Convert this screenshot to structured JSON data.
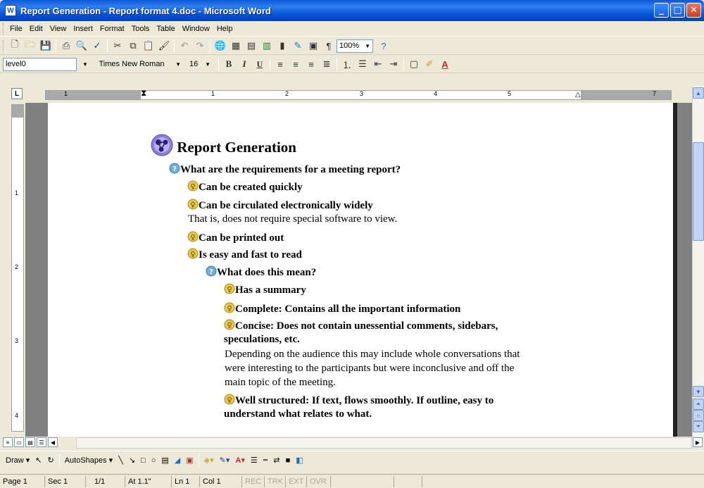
{
  "window": {
    "title": "Report Generation - Report format 4.doc - Microsoft Word",
    "icon": "W"
  },
  "menu": [
    "File",
    "Edit",
    "View",
    "Insert",
    "Format",
    "Tools",
    "Table",
    "Window",
    "Help"
  ],
  "toolbar": {
    "zoom": "100%",
    "style": "level0",
    "font": "Times New Roman",
    "size": "16",
    "bold": "B",
    "italic": "I",
    "underline": "U"
  },
  "ruler": {
    "tab_selector": "L",
    "h_numbers": [
      "1",
      "1",
      "2",
      "3",
      "4",
      "5",
      "7"
    ],
    "v_numbers": [
      "1",
      "2",
      "3",
      "4"
    ]
  },
  "document": {
    "title": "Report Generation",
    "q1": "What are the requirements for a meeting report?",
    "i1": "Can be created quickly",
    "i2": "Can be circulated electronically widely",
    "i2_note": "That is, does not require special software to view.",
    "i3": "Can be printed out",
    "i4": "Is easy and fast to read",
    "q2": "What does this mean?",
    "s1": "Has a summary",
    "s2": "Complete: Contains all the important information",
    "s3a": "Concise: Does not contain unessential comments, sidebars,",
    "s3b": "speculations, etc.",
    "s3_note1": "Depending on the audience this may include whole conversations that",
    "s3_note2": "were interesting to the participants but were inconclusive and off the",
    "s3_note3": "main topic of the meeting.",
    "s4a": "Well structured: If text, flows smoothly. If outline, easy to",
    "s4b": "understand what relates to what."
  },
  "drawbar": {
    "draw": "Draw",
    "autoshapes": "AutoShapes"
  },
  "status": {
    "page": "Page 1",
    "sec": "Sec 1",
    "pages": "1/1",
    "at": "At 1.1\"",
    "ln": "Ln 1",
    "col": "Col 1",
    "rec": "REC",
    "trk": "TRK",
    "ext": "EXT",
    "ovr": "OVR"
  },
  "colors": {
    "titlebar": "#0a5ad8",
    "bulb": "#e6c84a",
    "question": "#6fb0d8",
    "topic": "#6a5acd"
  }
}
